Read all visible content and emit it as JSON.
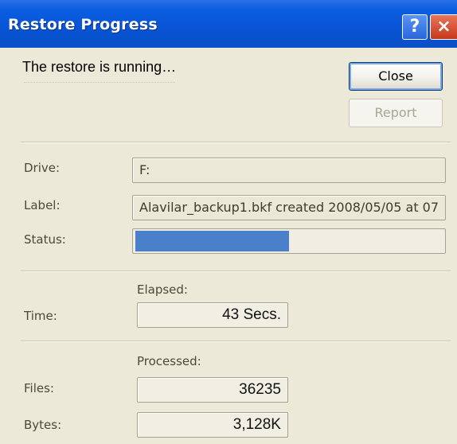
{
  "window": {
    "title": "Restore Progress",
    "help_glyph": "?",
    "close_glyph": "×"
  },
  "message": "The restore is running…",
  "buttons": {
    "close_label": "Close",
    "report_label": "Report"
  },
  "details": {
    "drive_label": "Drive:",
    "drive_value": "F:",
    "label_label": "Label:",
    "label_value": "Alavilar_backup1.bkf created 2008/05/05 at 07",
    "status_label": "Status:",
    "status_progress": 0.5
  },
  "time": {
    "header": "Elapsed:",
    "label": "Time:",
    "value": "43 Secs."
  },
  "processed": {
    "header": "Processed:",
    "files_label": "Files:",
    "files_value": "36235",
    "bytes_label": "Bytes:",
    "bytes_value": "3,128K"
  },
  "colors": {
    "title_bar": "#0a5de0",
    "progress_fill": "#4a7fc9",
    "close_button": "#c7391b",
    "window_bg": "#ece9d8"
  }
}
